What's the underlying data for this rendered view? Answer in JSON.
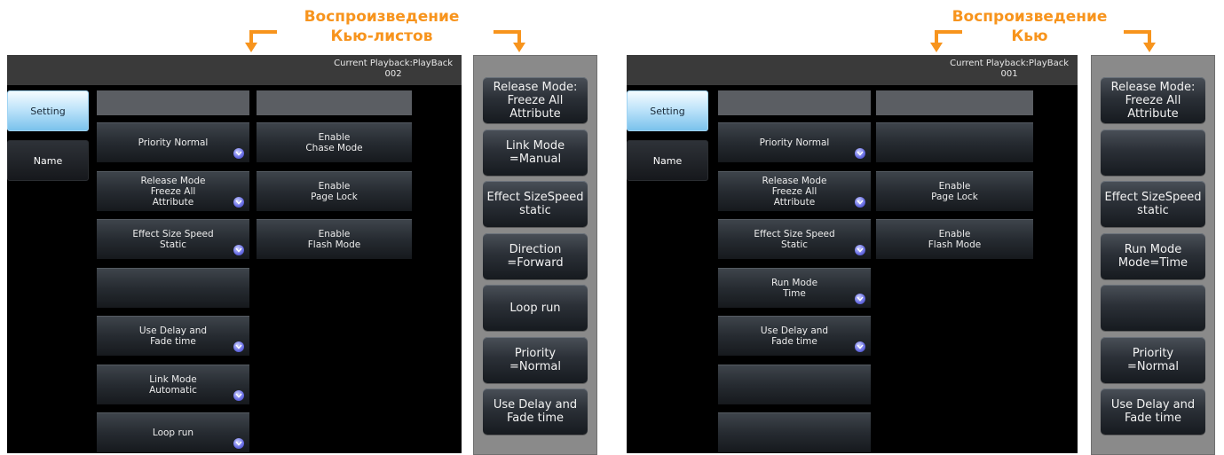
{
  "annotations": {
    "left_title": "Воспроизведение\nКью-листов",
    "right_title": "Воспроизведение\nКью"
  },
  "left_screen": {
    "current_playback": "Current Playback:PlayBack\n002",
    "tabs": [
      "Setting",
      "Name"
    ],
    "col1": [
      {
        "label": "Priority Normal",
        "chev": true
      },
      {
        "label": "Release Mode\nFreeze All\nAttribute",
        "chev": true
      },
      {
        "label": "Effect Size Speed\nStatic",
        "chev": true
      },
      {
        "label": "",
        "chev": false
      },
      {
        "label": "Use Delay and\nFade time",
        "chev": true
      },
      {
        "label": "Link Mode\nAutomatic",
        "chev": true
      },
      {
        "label": "Loop run",
        "chev": true
      }
    ],
    "col2": [
      {
        "label": "Enable\nChase Mode",
        "chev": false
      },
      {
        "label": "Enable\nPage Lock",
        "chev": false
      },
      {
        "label": "Enable\nFlash Mode",
        "chev": false
      }
    ]
  },
  "left_panel": {
    "buttons": [
      "Release Mode:\nFreeze All\nAttribute",
      "Link Mode\n=Manual",
      "Effect SizeSpeed\nstatic",
      "Direction\n=Forward",
      "Loop run",
      "Priority\n=Normal",
      "Use Delay and\nFade time"
    ]
  },
  "right_screen": {
    "current_playback": "Current Playback:PlayBack\n001",
    "tabs": [
      "Setting",
      "Name"
    ],
    "col1": [
      {
        "label": "Priority Normal",
        "chev": true
      },
      {
        "label": "Release Mode\nFreeze All\nAttribute",
        "chev": true
      },
      {
        "label": "Effect Size Speed\nStatic",
        "chev": true
      },
      {
        "label": "Run Mode\nTime",
        "chev": true
      },
      {
        "label": "Use Delay and\nFade time",
        "chev": true
      },
      {
        "label": "",
        "chev": false
      },
      {
        "label": "",
        "chev": false
      }
    ],
    "col2": [
      {
        "label": "",
        "chev": false
      },
      {
        "label": "Enable\nPage Lock",
        "chev": false
      },
      {
        "label": "Enable\nFlash Mode",
        "chev": false
      }
    ]
  },
  "right_panel": {
    "buttons": [
      "Release Mode:\nFreeze All\nAttribute",
      "",
      "Effect SizeSpeed\nstatic",
      "Run Mode\nMode=Time",
      "",
      "Priority\n=Normal",
      "Use Delay and\nFade time"
    ]
  },
  "colors": {
    "annotation": "#f7941d",
    "screen_bg": "#000000",
    "panel_bg": "#8a8a8a"
  }
}
